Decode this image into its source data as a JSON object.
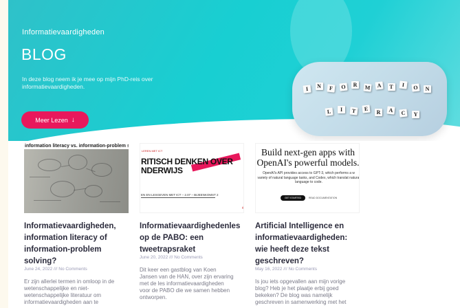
{
  "hero": {
    "subtitle": "Informatievaardigheden",
    "title": "BLOG",
    "description": "In deze blog neem ik je mee op mijn PhD-reis over informatievaardigheden.",
    "cta_label": "Meer Lezen",
    "cta_icon": "arrow-down-icon",
    "accent_color": "#e8185c",
    "gradient_colors": [
      "#2fc1c9",
      "#1fd0d5",
      "#62dde0"
    ]
  },
  "hero_image": {
    "line1": [
      "I",
      "N",
      "F",
      "O",
      "R",
      "M",
      "A",
      "T",
      "I",
      "O",
      "N"
    ],
    "line2": [
      "L",
      "I",
      "T",
      "E",
      "R",
      "A",
      "C",
      "Y"
    ]
  },
  "posts": [
    {
      "thumb_caption": "information literacy vs. information-problem solving",
      "title": "Informatievaardigheden, information literacy of information-problem solving?",
      "title_lines": [
        "Informatievaardigheden,",
        "information literacy of",
        "information-problem",
        "solving?"
      ],
      "date": "June 24, 2022",
      "comments": "No Comments",
      "excerpt_lines": [
        "Er zijn allerlei termen in omloop in de",
        "wetenschappelijke en niet-",
        "wetenschappelijke literatuur om",
        "informatievaardigheden aan te"
      ]
    },
    {
      "thumb_tag": "LEREN MET ICT",
      "thumb_head_lines": [
        "RITISCH DENKEN OVER",
        "NDERWIJS"
      ],
      "thumb_footer": "EN EN LESGEVEN MET ICT – 2.07 – BIJEENKOMST 2",
      "title": "Informatievaardighedenles op de PABO: een tweetrapsraket",
      "title_lines": [
        "Informatievaardighedenles",
        "op de PABO: een",
        "tweetrapsraket"
      ],
      "date": "June 20, 2022",
      "comments": "No Comments",
      "excerpt_lines": [
        "Dit keer een gastblog van Koen",
        "Jansen van de HAN, over zijn ervaring",
        "met de les informatievaardigheden",
        "voor de PABO die we samen hebben",
        "ontworpen."
      ]
    },
    {
      "thumb_head_lines": [
        "Build next-gen apps with",
        "OpenAI's powerful models."
      ],
      "thumb_desc": "OpenAI's API provides access to GPT-3, which performs a w variety of natural language tasks, and Codex, which translat natural language to code.",
      "thumb_button": "GET STARTED",
      "thumb_link": "READ DOCUMENTATION",
      "title": "Artificial Intelligence en informatievaardigheden: wie heeft deze tekst geschreven?",
      "title_lines": [
        "Artificial Intelligence en",
        "informatievaardigheden:",
        "wie heeft deze tekst",
        "geschreven?"
      ],
      "date": "May 16, 2022",
      "comments": "No Comments",
      "excerpt_lines": [
        "Is jou iets opgevallen aan mijn vorige",
        "blog? Heb je het plaatje erbij goed",
        "bekeken? De blog was namelijk",
        "geschreven in samenwerking met het"
      ]
    }
  ],
  "meta_separator": "///"
}
